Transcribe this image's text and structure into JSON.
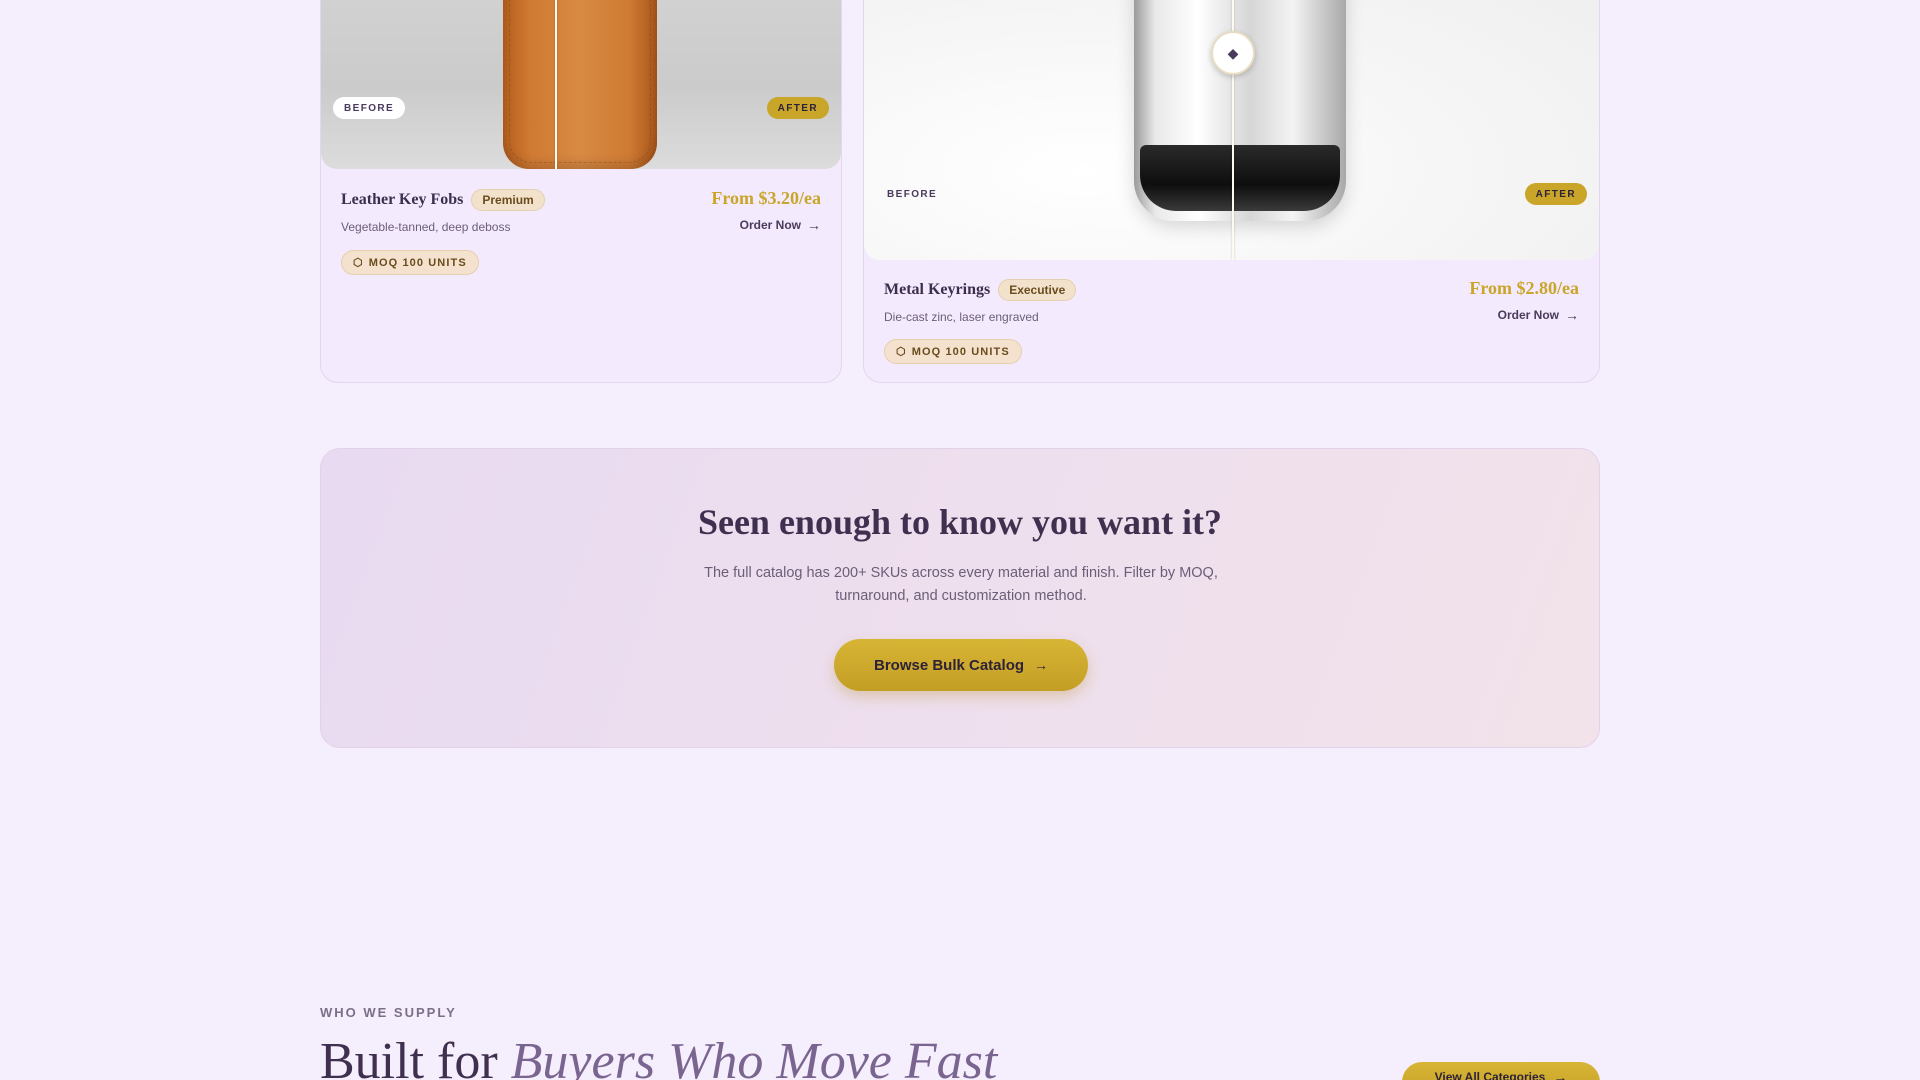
{
  "products": [
    {
      "name": "Leather Key Fobs",
      "badge": "Premium",
      "description": "Vegetable-tanned, deep deboss",
      "price": "From $3.20/ea",
      "order_label": "Order Now",
      "moq": "MOQ 100 UNITS",
      "before_label": "BEFORE",
      "after_label": "AFTER",
      "slider_position": 0.45
    },
    {
      "name": "Metal Keyrings",
      "badge": "Executive",
      "description": "Die-cast zinc, laser engraved",
      "price": "From $2.80/ea",
      "order_label": "Order Now",
      "moq": "MOQ 100 UNITS",
      "before_label": "BEFORE",
      "after_label": "AFTER",
      "slider_position": 0.5
    }
  ],
  "cta": {
    "title": "Seen enough to know you want it?",
    "text": "The full catalog has 200+ SKUs across every material and finish. Filter by MOQ, turnaround, and customization method.",
    "button_label": "Browse Bulk Catalog"
  },
  "supply": {
    "eyebrow": "WHO WE SUPPLY",
    "title_plain": "Built for ",
    "title_italic": "Buyers Who Move Fast",
    "button_label": "View All Categories"
  },
  "icons": {
    "arrow": "arrow-right-icon",
    "slider": "slider-handle-icon",
    "moq": "box-icon"
  },
  "colors": {
    "accent_gold": "#c9a52a",
    "background": "#f5eefd",
    "text_dark": "#40304f"
  }
}
